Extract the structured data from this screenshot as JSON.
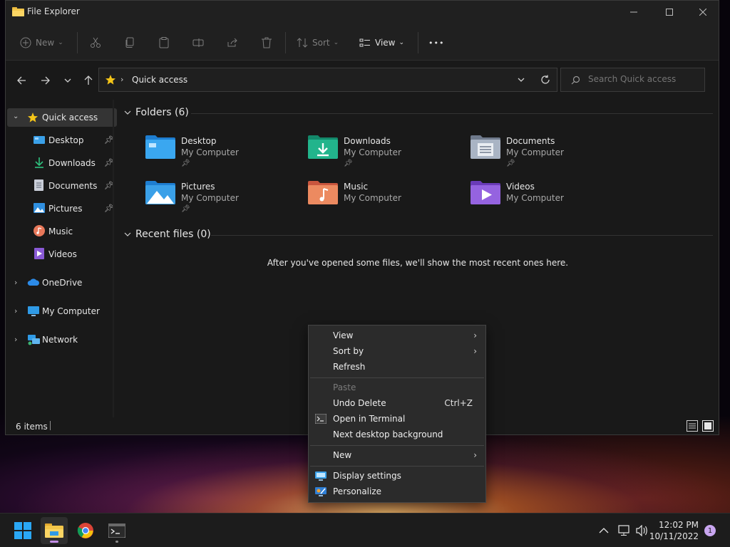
{
  "window": {
    "title": "File Explorer",
    "controls": [
      "minimize",
      "maximize",
      "close"
    ]
  },
  "toolbar": {
    "new_label": "New",
    "sort_label": "Sort",
    "view_label": "View",
    "more_label": "•••"
  },
  "address": {
    "location": "Quick access",
    "search_placeholder": "Search Quick access"
  },
  "sidebar": {
    "quick_access": "Quick access",
    "items": [
      {
        "label": "Desktop",
        "icon": "desktop-icon",
        "pinned": true
      },
      {
        "label": "Downloads",
        "icon": "downloads-icon",
        "pinned": true
      },
      {
        "label": "Documents",
        "icon": "documents-icon",
        "pinned": true
      },
      {
        "label": "Pictures",
        "icon": "pictures-icon",
        "pinned": true
      },
      {
        "label": "Music",
        "icon": "music-icon",
        "pinned": false
      },
      {
        "label": "Videos",
        "icon": "videos-icon",
        "pinned": false
      }
    ],
    "roots": [
      {
        "label": "OneDrive",
        "icon": "onedrive-icon"
      },
      {
        "label": "My Computer",
        "icon": "computer-icon"
      },
      {
        "label": "Network",
        "icon": "network-icon"
      }
    ]
  },
  "content": {
    "folders_header": "Folders (6)",
    "folders": [
      {
        "name": "Desktop",
        "sub": "My Computer",
        "pinned": true
      },
      {
        "name": "Downloads",
        "sub": "My Computer",
        "pinned": true
      },
      {
        "name": "Documents",
        "sub": "My Computer",
        "pinned": true
      },
      {
        "name": "Pictures",
        "sub": "My Computer",
        "pinned": true
      },
      {
        "name": "Music",
        "sub": "My Computer",
        "pinned": false
      },
      {
        "name": "Videos",
        "sub": "My Computer",
        "pinned": false
      }
    ],
    "recent_header": "Recent files (0)",
    "empty_message": "After you've opened some files, we'll show the most recent ones here."
  },
  "status": {
    "items_count": "6 items"
  },
  "context_menu": {
    "view": "View",
    "sort_by": "Sort by",
    "refresh": "Refresh",
    "paste": "Paste",
    "undo_delete": "Undo Delete",
    "undo_shortcut": "Ctrl+Z",
    "open_terminal": "Open in Terminal",
    "next_background": "Next desktop background",
    "new": "New",
    "display_settings": "Display settings",
    "personalize": "Personalize"
  },
  "taskbar": {
    "time": "12:02 PM",
    "date": "10/11/2022",
    "notification_count": "1"
  },
  "colors": {
    "accent": "#c38ee6",
    "folder_blue": "#3aa0e8",
    "folder_green": "#1fb38a",
    "folder_gray": "#8e9bb0",
    "folder_orange": "#e8865a",
    "folder_purple": "#8a5ad6"
  }
}
